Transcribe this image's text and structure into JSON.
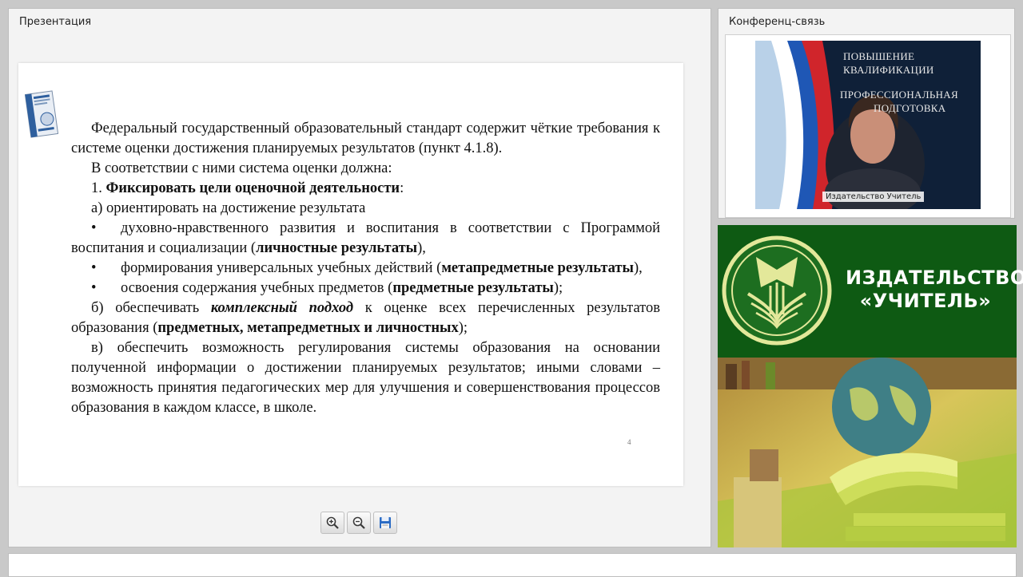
{
  "presentation": {
    "title": "Презентация",
    "slide": {
      "paragraphs": [
        {
          "type": "indent",
          "parts": [
            {
              "t": "Федеральный государственный образовательный стандарт содержит чёткие требования к системе оценки достижения планируемых результатов (пункт 4.1.8).",
              "b": false
            }
          ]
        },
        {
          "type": "indent",
          "parts": [
            {
              "t": "В соответствии с ними система оценки должна:",
              "b": false
            }
          ]
        },
        {
          "type": "indent",
          "parts": [
            {
              "t": "1. ",
              "b": false
            },
            {
              "t": "Фиксировать цели оценочной деятельности",
              "b": true
            },
            {
              "t": ":",
              "b": false
            }
          ]
        },
        {
          "type": "indent",
          "parts": [
            {
              "t": "а) ориентировать на достижение результата",
              "b": false
            }
          ]
        },
        {
          "type": "bullet",
          "parts": [
            {
              "t": "духовно-нравственного развития и воспитания   в соответствии с Программой воспитания и  социализации (",
              "b": false
            },
            {
              "t": "личностные результаты",
              "b": true
            },
            {
              "t": "),",
              "b": false
            }
          ]
        },
        {
          "type": "bullet",
          "parts": [
            {
              "t": "формирования универсальных учебных действий (",
              "b": false
            },
            {
              "t": "метапредметные результаты",
              "b": true
            },
            {
              "t": "),",
              "b": false
            }
          ]
        },
        {
          "type": "bullet",
          "parts": [
            {
              "t": "освоения содержания учебных предметов (",
              "b": false
            },
            {
              "t": "предметные результаты",
              "b": true
            },
            {
              "t": ");",
              "b": false
            }
          ]
        },
        {
          "type": "indent",
          "parts": [
            {
              "t": "б) обеспечивать ",
              "b": false
            },
            {
              "t": "комплексный подход",
              "b": true,
              "i": true
            },
            {
              "t": " к оценке всех перечисленных результатов образования (",
              "b": false
            },
            {
              "t": "предметных, метапредметных и личностных",
              "b": true
            },
            {
              "t": ");",
              "b": false
            }
          ]
        },
        {
          "type": "indent",
          "parts": [
            {
              "t": "в) обеспечить возможность регулирования системы образования на основании полученной информации о достижении планируемых результатов; иными словами – возможность принятия педагогических мер для улучшения и совершенствования процессов образования в каждом классе, в школе.",
              "b": false
            }
          ]
        }
      ],
      "bullet_symbol": "•",
      "page_number": "4"
    },
    "toolbar": {
      "zoom_in_icon": "zoom-in-icon",
      "zoom_out_icon": "zoom-out-icon",
      "save_icon": "save-icon"
    }
  },
  "conference": {
    "title": "Конференц-связь",
    "participant_name": "Издательство Учитель",
    "backdrop_lines": [
      "ПОВЫШЕНИЕ",
      "КВАЛИФИКАЦИИ",
      "ПРОФЕССИОНАЛЬНАЯ",
      "ПОДГОТОВКА"
    ]
  },
  "logo": {
    "line1": "ИЗДАТЕЛЬСТВО",
    "line2": "«УЧИТЕЛЬ»"
  },
  "colors": {
    "logo_green": "#0e5a13",
    "panel_bg": "#f3f3f3"
  }
}
